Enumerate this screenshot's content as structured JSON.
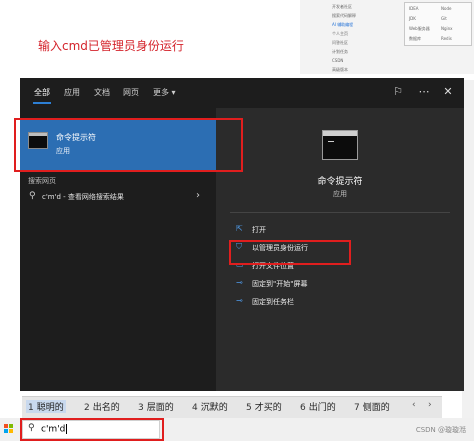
{
  "document": {
    "heading": "输入cmd已管理员身份运行",
    "bg_menu": [
      "开发者社区",
      "搜索代码解释",
      "AI 辅助编程",
      "个人主页",
      "问答社区",
      "计划任务",
      "CSDN",
      "高级版本"
    ],
    "bg_box": [
      "IDEA",
      "Node",
      "JDK",
      "Git",
      "Web服务器",
      "Nginx",
      "数据库",
      "Redis"
    ]
  },
  "start_menu": {
    "tabs": [
      "全部",
      "应用",
      "文档",
      "网页",
      "更多"
    ],
    "more_arrow": "▾",
    "icons": {
      "feedback": "feedback-icon",
      "options": "more-options-icon",
      "close": "close-icon"
    },
    "best_match": {
      "name": "命令提示符",
      "type": "应用"
    },
    "web_section_header": "搜索网页",
    "web_result": "c'm'd - 查看网络搜索结果",
    "preview": {
      "name": "命令提示符",
      "type": "应用"
    },
    "actions": [
      {
        "label": "打开",
        "icon": "open-icon"
      },
      {
        "label": "以管理员身份运行",
        "icon": "admin-shield-icon"
      },
      {
        "label": "打开文件位置",
        "icon": "folder-icon"
      },
      {
        "label": "固定到\"开始\"屏幕",
        "icon": "pin-icon"
      },
      {
        "label": "固定到任务栏",
        "icon": "pin-icon"
      }
    ]
  },
  "ime": {
    "candidates": [
      {
        "n": "1",
        "text": "聪明的"
      },
      {
        "n": "2",
        "text": "出名的"
      },
      {
        "n": "3",
        "text": "层面的"
      },
      {
        "n": "4",
        "text": "沉默的"
      },
      {
        "n": "5",
        "text": "才买的"
      },
      {
        "n": "6",
        "text": "出门的"
      },
      {
        "n": "7",
        "text": "侧面的"
      }
    ],
    "prev": "‹",
    "next": "›"
  },
  "taskbar": {
    "search_value": "c'm'd",
    "watermark": "CSDN @璇璇湉"
  },
  "colors": {
    "accent": "#2c6eb3",
    "annotation": "#e01e1e",
    "panel": "#1d1d1d"
  }
}
